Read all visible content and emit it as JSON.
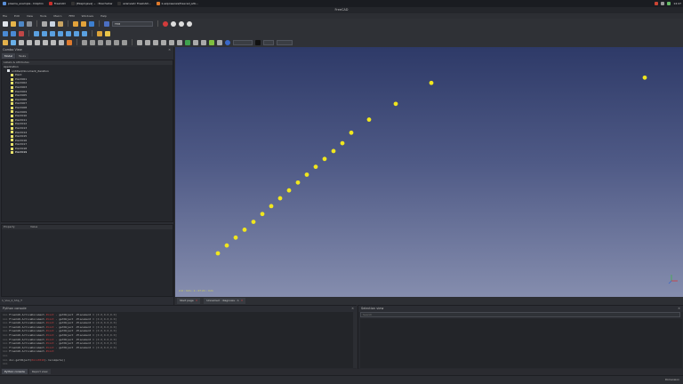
{
  "taskbar": {
    "tasks": [
      "plasma_example - Dolphin",
      "FreeCAD",
      "[Ezaplnjava] ~ : Ezachvlkw",
      "ezanviwlc FreeCAD...",
      "k-ezpowerws/freecad_sdk..."
    ],
    "tray_time": "14:47"
  },
  "window": {
    "title": "FreeCAD"
  },
  "menu": [
    "File",
    "Edit",
    "View",
    "Tools",
    "Macro",
    "FEM",
    "Windows",
    "Help"
  ],
  "toolbar": {
    "workbench": "FEM"
  },
  "left": {
    "title": "Combo View",
    "tabs": [
      "Model",
      "Tasks"
    ],
    "tree_header": "Labels & Attributes",
    "application": "Application",
    "document": "untitled/document_iteration",
    "items": [
      "Point",
      "Point001",
      "Point002",
      "Point003",
      "Point004",
      "Point005",
      "Point006",
      "Point007",
      "Point008",
      "Point009",
      "Point010",
      "Point011",
      "Point012",
      "Point013",
      "Point014",
      "Point015",
      "Point016",
      "Point017",
      "Point018",
      "Point019"
    ],
    "prop_headers": [
      "Property",
      "Value"
    ],
    "status": "1_Vue_0_Shp_T"
  },
  "viewport": {
    "status_text": "2.0 ; mm ; 1 ; 27.21 ; mm",
    "tabs": [
      "Start page",
      "Unnamed : diagnosis : 1"
    ]
  },
  "chart_data": {
    "type": "scatter",
    "points": [
      [
        0,
        0
      ],
      [
        1,
        1.5
      ],
      [
        2,
        3
      ],
      [
        3,
        4.5
      ],
      [
        4,
        6
      ],
      [
        5,
        7.5
      ],
      [
        6,
        9
      ],
      [
        7,
        10.5
      ],
      [
        8,
        12
      ],
      [
        9,
        13.5
      ],
      [
        10,
        15
      ],
      [
        11,
        16.5
      ],
      [
        12,
        18
      ],
      [
        13,
        19.5
      ],
      [
        14,
        21
      ],
      [
        15,
        23
      ],
      [
        17,
        25.5
      ],
      [
        20,
        28.5
      ],
      [
        24,
        32.5
      ],
      [
        48,
        33.5
      ]
    ]
  },
  "console": {
    "title": "Python console",
    "lines": [
      {
        "p": ">>> ",
        "a": "FreeCAD.ActiveDocument.",
        "k": "Point",
        "b": " . ",
        "c": "getObject",
        "d": " .Placement = ",
        "e": "[0.0,0.0,0.0]"
      },
      {
        "p": ">>> ",
        "a": "FreeCAD.ActiveDocument.",
        "k": "Point",
        "b": " . ",
        "c": "getObject",
        "d": " .Placement = ",
        "e": "[0.0,0.0,0.0]"
      },
      {
        "p": ">>> ",
        "a": "FreeCAD.ActiveDocument.",
        "k": "Point",
        "b": " . ",
        "c": "getObject",
        "d": " .Placement = ",
        "e": "[0.0,0.0,0.0]"
      },
      {
        "p": ">>> ",
        "a": "FreeCAD.ActiveDocument.",
        "k": "Point",
        "b": " . ",
        "c": "getObject",
        "d": " .Placement = ",
        "e": "[0.0,0.0,0.0]"
      },
      {
        "p": ">>> ",
        "a": "FreeCAD.ActiveDocument.",
        "k": "Point",
        "b": " . ",
        "c": "getObject",
        "d": " .Placement = ",
        "e": "[0.0,0.0,0.0]"
      },
      {
        "p": ">>> ",
        "a": "FreeCAD.ActiveDocument.",
        "k": "Point",
        "b": " . ",
        "c": "getObject",
        "d": " .Placement = ",
        "e": "[0.0,0.0,0.0]"
      },
      {
        "p": ">>> ",
        "a": "FreeCAD.ActiveDocument.",
        "k": "Point",
        "b": " . ",
        "c": "getObject",
        "d": " .Placement = ",
        "e": "[0.0,0.0,0.0]"
      },
      {
        "p": ">>> ",
        "a": "FreeCAD.ActiveDocument.",
        "k": "Point",
        "b": " . ",
        "c": "getObject",
        "d": " .Placement = ",
        "e": "[0.0,0.0,0.0]"
      },
      {
        "p": ">>> ",
        "a": "FreeCAD.ActiveDocument.",
        "k": "Point",
        "b": " . ",
        "c": "getObject",
        "d": " .Placement = ",
        "e": "[0.0,0.0,0.0]"
      },
      {
        "p": ">>> ",
        "a": "FreeCAD.ActiveDocument.",
        "k": "Point",
        "b": "",
        "c": "",
        "d": "",
        "e": ""
      },
      {
        "p": ">>> ",
        "a": "",
        "k": "",
        "b": "",
        "c": "",
        "d": "",
        "e": ""
      },
      {
        "p": ">>> ",
        "a": "doc.getObject(",
        "k": "Point019",
        "b": ").recompute()",
        "c": "",
        "d": "",
        "e": ""
      },
      {
        "p": ">>> ",
        "a": "",
        "k": "",
        "b": "",
        "c": "",
        "d": "",
        "e": ""
      }
    ]
  },
  "selection": {
    "title": "Selection view",
    "search_placeholder": "Search"
  },
  "bottom_tabs": [
    "Python console",
    "Report view"
  ],
  "statusbar": {
    "right": "Dimension"
  },
  "colors": {
    "point": "#f0e61e",
    "accent_red": "#d24242"
  }
}
